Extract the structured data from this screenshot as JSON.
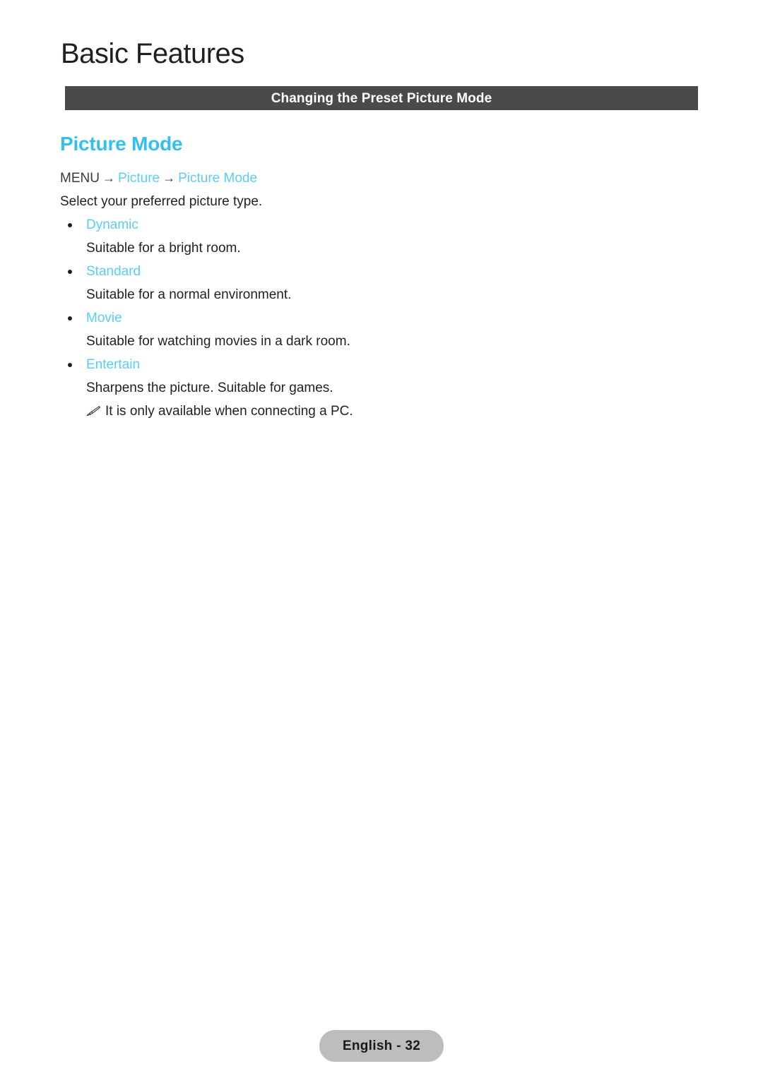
{
  "page": {
    "title": "Basic Features",
    "section_bar_label": "Changing the Preset Picture Mode",
    "accent_color": "#33bff0",
    "link_color": "#5bcdf5",
    "bar_color": "#4a4a4a",
    "footer_pill_color": "#bdbdbd",
    "background_color": "#ffffff"
  },
  "topic": {
    "heading": "Picture Mode",
    "breadcrumb": {
      "root": "MENU",
      "arrow": "→",
      "level1": "Picture",
      "level2": "Picture Mode"
    },
    "intro": "Select your preferred picture type.",
    "options": [
      {
        "name": "Dynamic",
        "description": "Suitable for a bright room."
      },
      {
        "name": "Standard",
        "description": "Suitable for a normal environment."
      },
      {
        "name": "Movie",
        "description": "Suitable for watching movies in a dark room."
      },
      {
        "name": "Entertain",
        "description": "Sharpens the picture. Suitable for games."
      }
    ],
    "note": {
      "icon": "pencil-note-icon",
      "text": "It is only available when connecting a PC."
    }
  },
  "footer": {
    "label": "English - 32"
  }
}
